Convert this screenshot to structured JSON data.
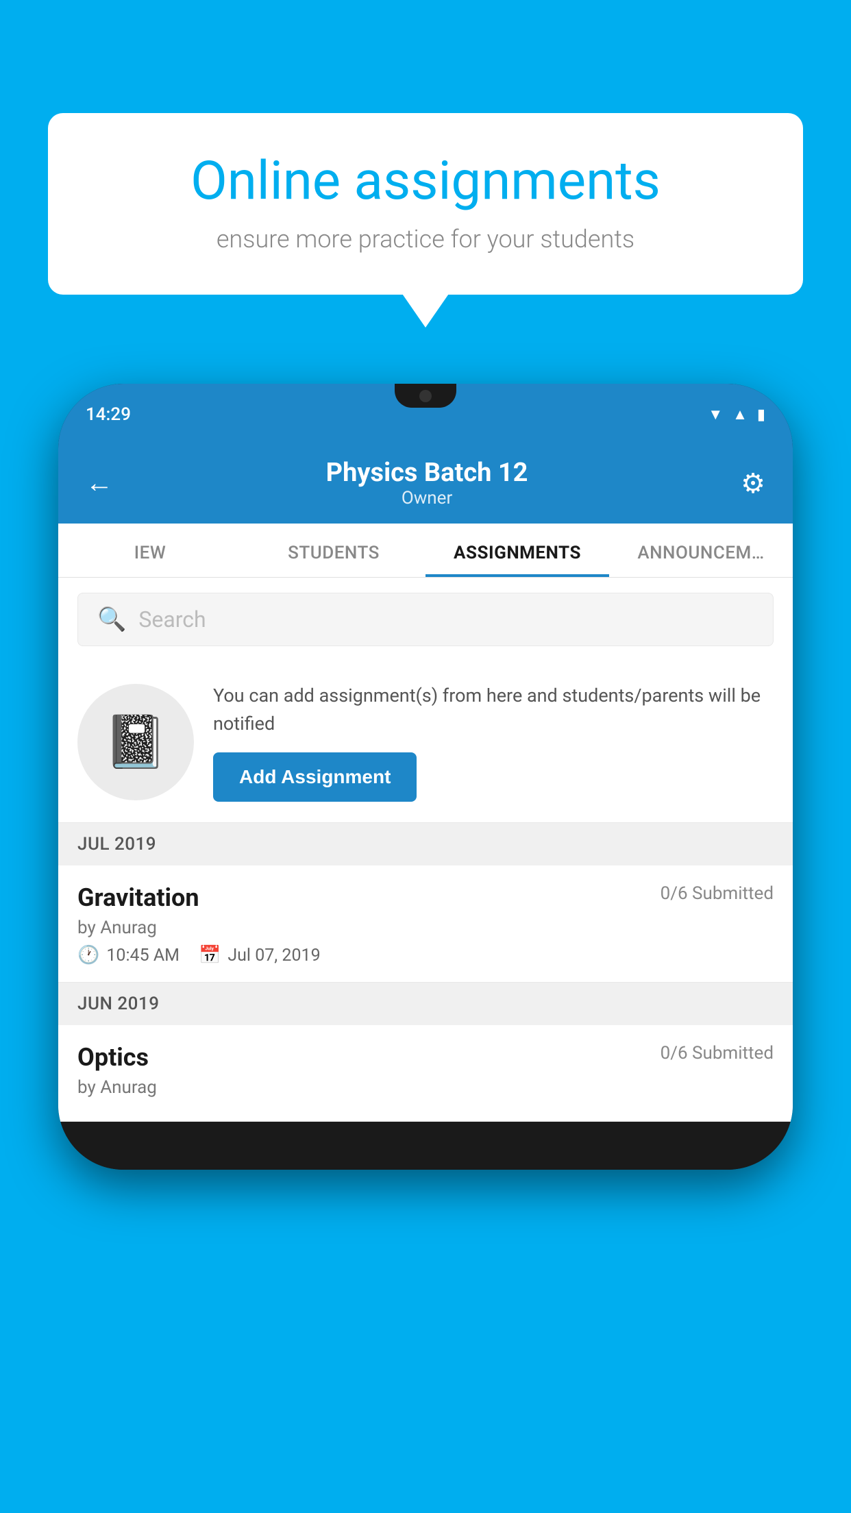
{
  "background_color": "#00AEEF",
  "bubble": {
    "title": "Online assignments",
    "subtitle": "ensure more practice for your students"
  },
  "phone": {
    "status_time": "14:29",
    "header": {
      "title": "Physics Batch 12",
      "subtitle": "Owner",
      "back_label": "←",
      "gear_label": "⚙"
    },
    "tabs": [
      {
        "label": "IEW",
        "active": false
      },
      {
        "label": "STUDENTS",
        "active": false
      },
      {
        "label": "ASSIGNMENTS",
        "active": true
      },
      {
        "label": "ANNOUNCEM…",
        "active": false
      }
    ],
    "search": {
      "placeholder": "Search"
    },
    "promo": {
      "description": "You can add assignment(s) from here and students/parents will be notified",
      "button_label": "Add Assignment"
    },
    "sections": [
      {
        "header": "JUL 2019",
        "assignments": [
          {
            "title": "Gravitation",
            "submitted": "0/6 Submitted",
            "author": "by Anurag",
            "time": "10:45 AM",
            "date": "Jul 07, 2019"
          }
        ]
      },
      {
        "header": "JUN 2019",
        "assignments": [
          {
            "title": "Optics",
            "submitted": "0/6 Submitted",
            "author": "by Anurag",
            "time": "",
            "date": ""
          }
        ]
      }
    ]
  }
}
